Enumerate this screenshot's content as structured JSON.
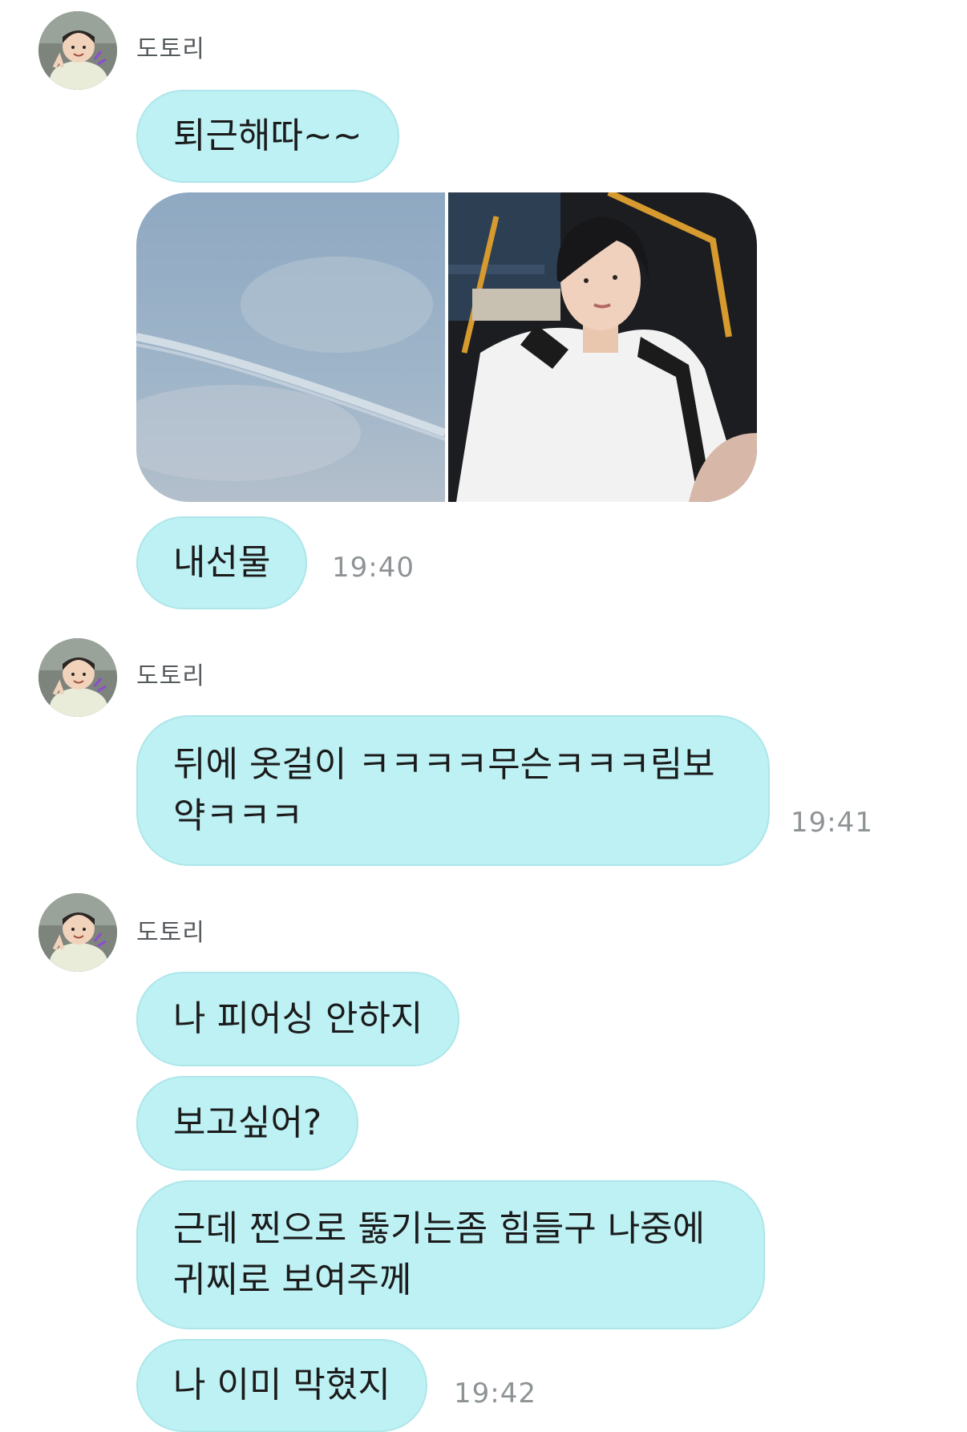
{
  "chat": {
    "groups": [
      {
        "sender": "도토리",
        "messages": [
          {
            "text": "퇴근해따~~"
          },
          {
            "type": "photos",
            "count": 2
          },
          {
            "text": "내선물",
            "time": "19:40"
          }
        ]
      },
      {
        "sender": "도토리",
        "messages": [
          {
            "line1": "뒤에 옷걸이 ㅋㅋㅋㅋ무슨ㅋㅋㅋ림보",
            "line2": "약ㅋㅋㅋ",
            "time": "19:41"
          }
        ]
      },
      {
        "sender": "도토리",
        "messages": [
          {
            "text": "나 피어싱 안하지"
          },
          {
            "text": "보고싶어?"
          },
          {
            "line1": "근데 찐으로 뚫기는좀 힘들구 나중에",
            "line2": "귀찌로 보여주께"
          },
          {
            "text": "나 이미 막혔지",
            "time": "19:42"
          }
        ]
      }
    ]
  },
  "icons": {
    "avatar": "profile-photo-icon"
  },
  "colors": {
    "bubble": "#bdf1f4",
    "bubble_border": "#aee6ea",
    "timestamp": "#8e9396",
    "sender": "#555a5d"
  }
}
